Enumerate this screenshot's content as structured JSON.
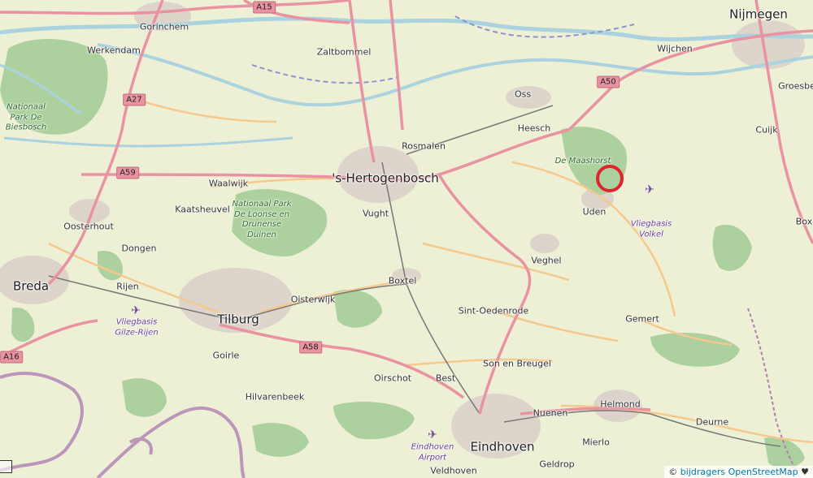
{
  "map": {
    "cities": [
      {
        "id": "nijmegen",
        "name": "Nijmegen"
      },
      {
        "id": "gorinchem",
        "name": "Gorinchem"
      },
      {
        "id": "werkendam",
        "name": "Werkendam"
      },
      {
        "id": "zaltbommel",
        "name": "Zaltbommel"
      },
      {
        "id": "wijchen",
        "name": "Wijchen"
      },
      {
        "id": "oss",
        "name": "Oss"
      },
      {
        "id": "groesbeek",
        "name": "Groesbe"
      },
      {
        "id": "cuijk",
        "name": "Cuijk"
      },
      {
        "id": "heesch",
        "name": "Heesch"
      },
      {
        "id": "rosmalen",
        "name": "Rosmalen"
      },
      {
        "id": "hertogenbosch",
        "name": "'s-Hertogenbosch"
      },
      {
        "id": "waalwijk",
        "name": "Waalwijk"
      },
      {
        "id": "kaatsheuvel",
        "name": "Kaatsheuvel"
      },
      {
        "id": "vught",
        "name": "Vught"
      },
      {
        "id": "uden",
        "name": "Uden"
      },
      {
        "id": "boxmeer",
        "name": "Box"
      },
      {
        "id": "oosterhout",
        "name": "Oosterhout"
      },
      {
        "id": "dongen",
        "name": "Dongen"
      },
      {
        "id": "veghel",
        "name": "Veghel"
      },
      {
        "id": "breda",
        "name": "Breda"
      },
      {
        "id": "rijen",
        "name": "Rijen"
      },
      {
        "id": "boxtel",
        "name": "Boxtel"
      },
      {
        "id": "oisterwijk",
        "name": "Oisterwijk"
      },
      {
        "id": "tilburg",
        "name": "Tilburg"
      },
      {
        "id": "sint-oedenrode",
        "name": "Sint-Oedenrode"
      },
      {
        "id": "gemert",
        "name": "Gemert"
      },
      {
        "id": "goirle",
        "name": "Goirle"
      },
      {
        "id": "son-en-breugel",
        "name": "Son en Breugel"
      },
      {
        "id": "oirschot",
        "name": "Oirschot"
      },
      {
        "id": "best",
        "name": "Best"
      },
      {
        "id": "hilvarenbeek",
        "name": "Hilvarenbeek"
      },
      {
        "id": "helmond",
        "name": "Helmond"
      },
      {
        "id": "nuenen",
        "name": "Nuenen"
      },
      {
        "id": "deurne",
        "name": "Deurne"
      },
      {
        "id": "mierlo",
        "name": "Mierlo"
      },
      {
        "id": "eindhoven",
        "name": "Eindhoven"
      },
      {
        "id": "geldrop",
        "name": "Geldrop"
      },
      {
        "id": "veldhoven",
        "name": "Veldhoven"
      }
    ],
    "parks": [
      {
        "id": "biesbosch",
        "name": "Nationaal Park De Biesbosch"
      },
      {
        "id": "loonse-drunense",
        "name": "Nationaal Park De Loonse en Drunense Duinen"
      },
      {
        "id": "maashorst",
        "name": "De Maashorst"
      }
    ],
    "airports": [
      {
        "id": "volkel",
        "name": "Vliegbasis Volkel"
      },
      {
        "id": "gilze-rijen",
        "name": "Vliegbasis Gilze-Rijen"
      },
      {
        "id": "eindhoven-airport",
        "name": "Eindhoven Airport"
      }
    ],
    "roads": [
      {
        "id": "a15",
        "ref": "A15"
      },
      {
        "id": "a27",
        "ref": "A27"
      },
      {
        "id": "a59",
        "ref": "A59"
      },
      {
        "id": "a50",
        "ref": "A50"
      },
      {
        "id": "a58",
        "ref": "A58"
      },
      {
        "id": "a16",
        "ref": "A16"
      }
    ],
    "marker": {
      "label": "location-marker",
      "color": "#e0242d"
    },
    "colors": {
      "land": "#f2efe9",
      "farmland": "#eef0d5",
      "forest": "#add19e",
      "motorway": "#e892a2",
      "primary": "#fcd6a4",
      "water": "#aad3df",
      "border": "#b07fb5",
      "urban": "#d9d0c9"
    }
  },
  "attribution": {
    "prefix": "©",
    "link": "bijdragers OpenStreetMap",
    "suffix": "♥"
  }
}
